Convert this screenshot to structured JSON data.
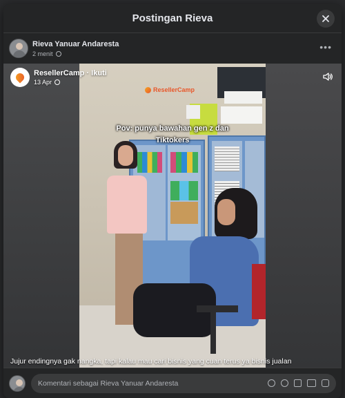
{
  "modal": {
    "title": "Postingan Rieva"
  },
  "post": {
    "author": "Rieva Yanuar Andaresta",
    "time": "2 menit",
    "more_label": "•••"
  },
  "shared": {
    "page_name": "ResellerCamp · Ikuti",
    "date": "13 Apr",
    "logo_text": "ResellerCamp",
    "overlay_line1": "Pov: punya bawahan gen z dan",
    "overlay_line2": "Tiktokers",
    "caption": "Jujur endingnya gak nangka, tapi kalau mau cari bisnis yang cuan terus ya bisnis jualan"
  },
  "comment": {
    "placeholder": "Komentari sebagai Rieva Yanuar Andaresta"
  },
  "colors": {
    "modal_bg": "#242526",
    "brand_orange": "#e8572a",
    "cabinet_blue": "#6d96c9"
  },
  "icons": [
    "close-icon",
    "globe-icon",
    "more-icon",
    "sound-icon",
    "sticker-icon",
    "emoji-icon",
    "camera-icon",
    "gif-icon",
    "avatar-sticker-icon"
  ]
}
